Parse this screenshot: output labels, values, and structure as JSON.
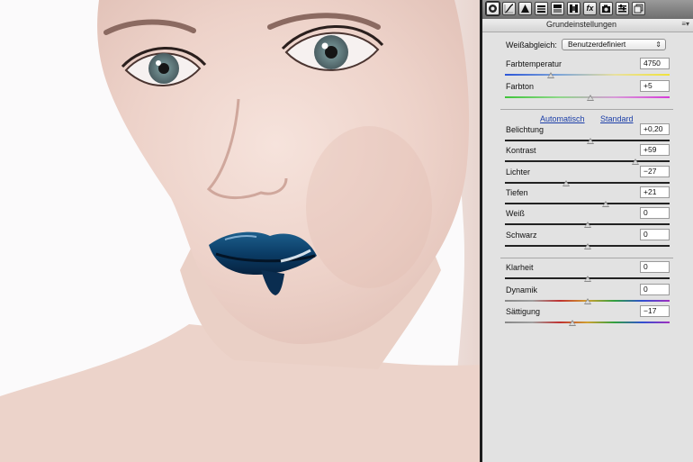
{
  "toolbar": {
    "tools": [
      "camera-aperture-icon",
      "tone-curve-icon",
      "detail-triangle-icon",
      "hsl-icon",
      "split-toning-icon",
      "lens-corrections-icon",
      "fx-icon",
      "camera-calibration-icon",
      "presets-icon",
      "snapshots-icon"
    ],
    "fx_label": "fx"
  },
  "panel": {
    "title": "Grundeinstellungen",
    "menu_glyph": "≡▾",
    "white_balance_label": "Weißabgleich:",
    "white_balance_value": "Benutzerdefiniert",
    "auto_link": "Automatisch",
    "default_link": "Standard"
  },
  "sliders": [
    {
      "label": "Farbtemperatur",
      "value": "4750",
      "position": 0.28
    },
    {
      "label": "Farbton",
      "value": "+5",
      "position": 0.52
    },
    {
      "label": "Belichtung",
      "value": "+0,20",
      "position": 0.52
    },
    {
      "label": "Kontrast",
      "value": "+59",
      "position": 0.79
    },
    {
      "label": "Lichter",
      "value": "−27",
      "position": 0.37
    },
    {
      "label": "Tiefen",
      "value": "+21",
      "position": 0.61
    },
    {
      "label": "Weiß",
      "value": "0",
      "position": 0.5
    },
    {
      "label": "Schwarz",
      "value": "0",
      "position": 0.5
    },
    {
      "label": "Klarheit",
      "value": "0",
      "position": 0.5
    },
    {
      "label": "Dynamik",
      "value": "0",
      "position": 0.5
    },
    {
      "label": "Sättigung",
      "value": "−17",
      "position": 0.41
    }
  ],
  "colors": {
    "temperature_gradient": [
      "#2c56d8",
      "#f0e23a"
    ],
    "tint_gradient": [
      "#3fc43a",
      "#d63ad8"
    ],
    "lip_color": "#0e3f6c"
  }
}
